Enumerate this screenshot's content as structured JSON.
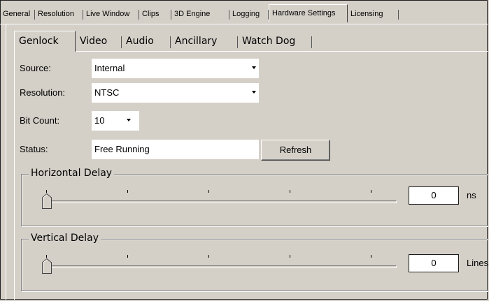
{
  "outer_tabs": [
    {
      "label": "General"
    },
    {
      "label": "Resolution"
    },
    {
      "label": "Live Window"
    },
    {
      "label": "Clips"
    },
    {
      "label": "3D Engine"
    },
    {
      "label": "Logging"
    },
    {
      "label": "Hardware Settings",
      "active": true
    },
    {
      "label": "Licensing"
    }
  ],
  "inner_tabs": [
    {
      "label": "Genlock",
      "active": true
    },
    {
      "label": "Video"
    },
    {
      "label": "Audio"
    },
    {
      "label": "Ancillary"
    },
    {
      "label": "Watch Dog"
    }
  ],
  "form": {
    "source_label": "Source:",
    "source_value": "Internal",
    "resolution_label": "Resolution:",
    "resolution_value": "NTSC",
    "bitcount_label": "Bit Count:",
    "bitcount_value": "10",
    "status_label": "Status:",
    "status_value": "Free Running",
    "refresh_label": "Refresh"
  },
  "horizontal_delay": {
    "title": "Horizontal Delay",
    "value": "0",
    "unit": "ns",
    "slider_level": 0
  },
  "vertical_delay": {
    "title": "Vertical Delay",
    "value": "0",
    "unit": "Lines",
    "slider_level": 0
  }
}
